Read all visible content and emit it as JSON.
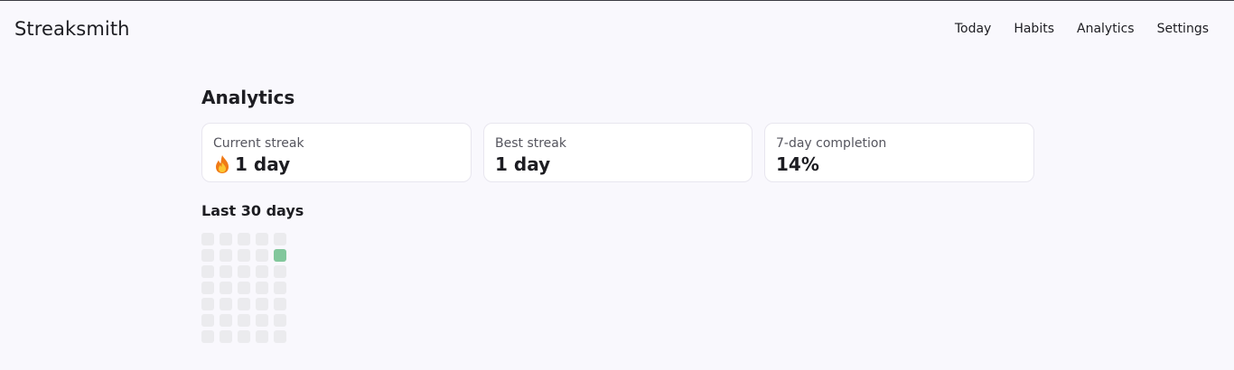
{
  "app": {
    "title": "Streaksmith"
  },
  "nav": [
    {
      "label": "Today"
    },
    {
      "label": "Habits"
    },
    {
      "label": "Analytics"
    },
    {
      "label": "Settings"
    }
  ],
  "page": {
    "title": "Analytics"
  },
  "stats": [
    {
      "label": "Current streak",
      "value": "1 day",
      "icon": "flame-icon"
    },
    {
      "label": "Best streak",
      "value": "1 day"
    },
    {
      "label": "7-day completion",
      "value": "14%"
    }
  ],
  "heatmap": {
    "title": "Last 30 days",
    "columns": 5,
    "days": [
      0,
      0,
      0,
      0,
      0,
      0,
      0,
      0,
      0,
      1,
      0,
      0,
      0,
      0,
      0,
      0,
      0,
      0,
      0,
      0,
      0,
      0,
      0,
      0,
      0,
      0,
      0,
      0,
      0,
      0,
      0,
      0,
      0,
      0,
      0
    ],
    "colors": {
      "empty": "#ebebee",
      "done": "#82c79c"
    }
  }
}
